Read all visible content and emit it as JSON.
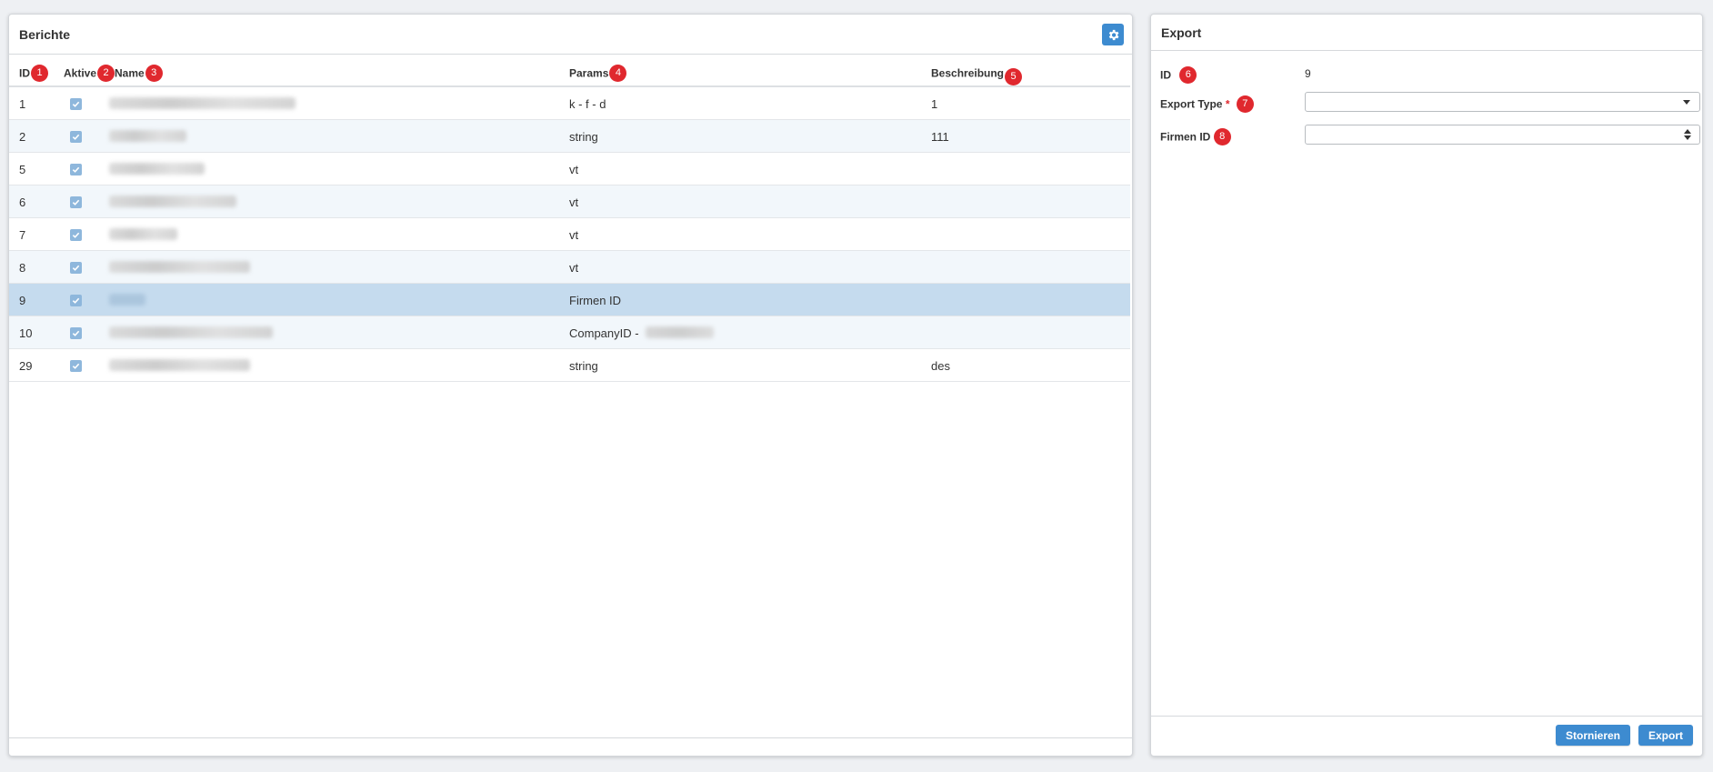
{
  "reports_panel": {
    "title": "Berichte",
    "settings_icon": "gear-icon",
    "columns": [
      {
        "label": "ID",
        "badge": "1"
      },
      {
        "label": "Aktive",
        "badge": "2"
      },
      {
        "label": "Name",
        "badge": "3"
      },
      {
        "label": "Params",
        "badge": "4"
      },
      {
        "label": "Beschreibung",
        "badge": "5"
      }
    ],
    "rows": [
      {
        "id": "1",
        "active": true,
        "params": "k - f - d",
        "description": "1"
      },
      {
        "id": "2",
        "active": true,
        "params": "string",
        "description": "111"
      },
      {
        "id": "5",
        "active": true,
        "params": "vt",
        "description": ""
      },
      {
        "id": "6",
        "active": true,
        "params": "vt",
        "description": ""
      },
      {
        "id": "7",
        "active": true,
        "params": "vt",
        "description": ""
      },
      {
        "id": "8",
        "active": true,
        "params": "vt",
        "description": ""
      },
      {
        "id": "9",
        "active": true,
        "params": "Firmen ID",
        "description": "",
        "selected": true
      },
      {
        "id": "10",
        "active": true,
        "params": "CompanyID -",
        "description": ""
      },
      {
        "id": "29",
        "active": true,
        "params": "string",
        "description": "des"
      }
    ]
  },
  "export_panel": {
    "title": "Export",
    "fields": {
      "id": {
        "label": "ID",
        "badge": "6",
        "value": "9"
      },
      "export_type": {
        "label": "Export Type",
        "required_mark": "*",
        "badge": "7",
        "value": ""
      },
      "firmen_id": {
        "label": "Firmen ID",
        "badge": "8",
        "value": ""
      }
    },
    "buttons": {
      "cancel": "Stornieren",
      "export": "Export"
    }
  },
  "colors": {
    "accent": "#3d8bd0",
    "badge": "#e0282e",
    "selected_row": "#c5dbee",
    "alt_row": "#f2f7fb",
    "checkbox": "#8eb7dc"
  }
}
